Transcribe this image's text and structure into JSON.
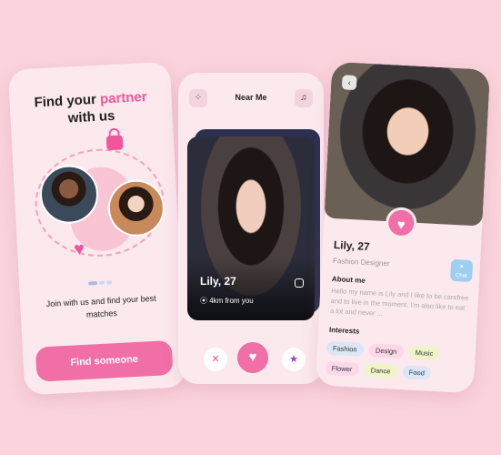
{
  "onboarding": {
    "title_line1": "Find your",
    "title_accent": "partner",
    "title_line2": "with us",
    "subtitle": "Join with us and find your best matches",
    "cta_label": "Find someone"
  },
  "near_me": {
    "header_title": "Near Me",
    "card": {
      "name": "Lily, 27",
      "distance": "4km from you"
    },
    "icons": [
      "grid-icon",
      "bell-icon",
      "close-icon",
      "heart-icon",
      "star-icon",
      "pin-icon",
      "instagram-icon"
    ]
  },
  "profile": {
    "name": "Lily, 27",
    "job": "Fashion Designer",
    "chat_label": "Chat",
    "about_heading": "About me",
    "about_text": "Hello my name is Lily and I like to be carefree and to live in the moment. I'm also like to eat a lot and never ...",
    "interests_heading": "Interests",
    "interests": [
      {
        "label": "Fashion",
        "color": "#dbe7f6"
      },
      {
        "label": "Design",
        "color": "#fcd7e8"
      },
      {
        "label": "Music",
        "color": "#eef6c8"
      },
      {
        "label": "Flower",
        "color": "#fcd7e8"
      },
      {
        "label": "Dance",
        "color": "#eef6c8"
      },
      {
        "label": "Food",
        "color": "#dbe7f6"
      }
    ]
  },
  "colors": {
    "accent": "#f06fa6",
    "background": "#fad3dc"
  }
}
